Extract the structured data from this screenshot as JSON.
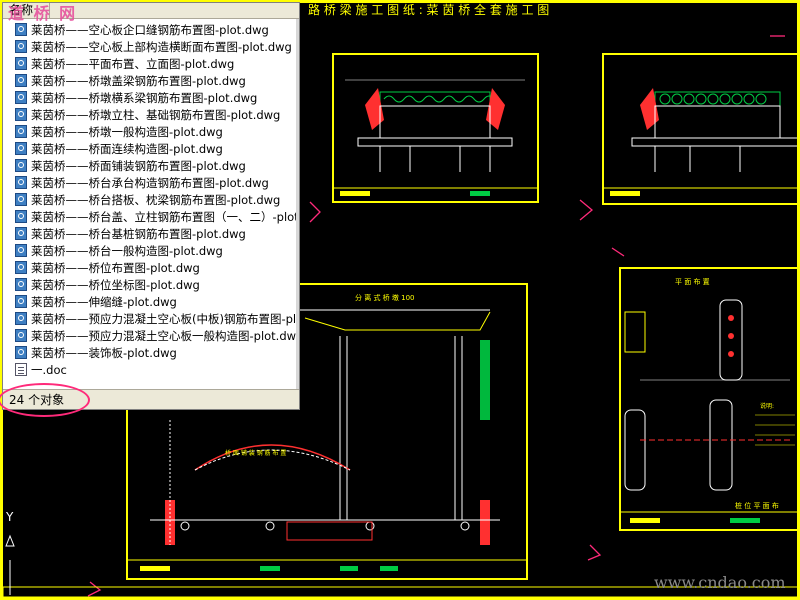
{
  "watermark_top": "道 桥 网",
  "watermark_bottom": "www.cndao.com",
  "menu_text": "路 桥 梁 施 工 图 纸 : 菜 茵 桥 全 套 施 工 图",
  "ucs_label": "Y",
  "panel": {
    "column_name": "名称",
    "files": [
      "莱茵桥——空心板企口缝钢筋布置图-plot.dwg",
      "莱茵桥——空心板上部构造横断面布置图-plot.dwg",
      "莱茵桥——平面布置、立面图-plot.dwg",
      "莱茵桥——桥墩盖梁钢筋布置图-plot.dwg",
      "莱茵桥——桥墩横系梁钢筋布置图-plot.dwg",
      "莱茵桥——桥墩立柱、基础钢筋布置图-plot.dwg",
      "莱茵桥——桥墩一般构造图-plot.dwg",
      "莱茵桥——桥面连续构造图-plot.dwg",
      "莱茵桥——桥面铺装钢筋布置图-plot.dwg",
      "莱茵桥——桥台承台构造钢筋布置图-plot.dwg",
      "莱茵桥——桥台搭板、枕梁钢筋布置图-plot.dwg",
      "莱茵桥——桥台盖、立柱钢筋布置图（一、二）-plot.dwg",
      "莱茵桥——桥台基桩钢筋布置图-plot.dwg",
      "莱茵桥——桥台一般构造图-plot.dwg",
      "莱茵桥——桥位布置图-plot.dwg",
      "莱茵桥——桥位坐标图-plot.dwg",
      "莱茵桥——伸缩缝-plot.dwg",
      "莱茵桥——预应力混凝土空心板(中板)钢筋布置图-plot.dwg",
      "莱茵桥——预应力混凝土空心板一般构造图-plot.dwg",
      "莱茵桥——装饰板-plot.dwg"
    ],
    "doc_file": "一.doc",
    "status": "24 个对象"
  },
  "drawings": {
    "center_title": "分 离 式 桥 墩 100",
    "right_title": "平 面 布 置",
    "right_title2": "桩 位 平 面 布",
    "arch_title": "桥 面 铺 装 钢 筋 布 置"
  },
  "colors": {
    "frame": "#ffff00",
    "line": "#ffffff",
    "accent_red": "#ff3030",
    "accent_green": "#00cc44",
    "accent_magenta": "#ff2a7a",
    "panel_bg": "#ffffff",
    "status_bg": "#ece9d8"
  }
}
